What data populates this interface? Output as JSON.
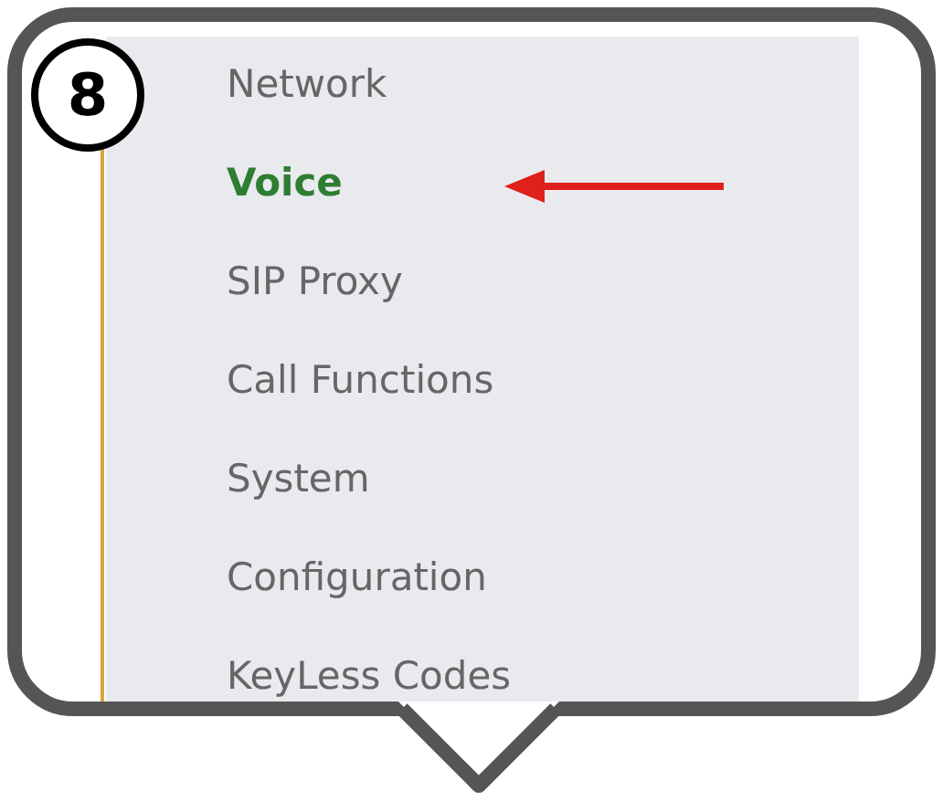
{
  "badge": "8",
  "menu": [
    {
      "label": "Network",
      "selected": false
    },
    {
      "label": "Voice",
      "selected": true
    },
    {
      "label": "SIP Proxy",
      "selected": false
    },
    {
      "label": "Call Functions",
      "selected": false
    },
    {
      "label": "System",
      "selected": false
    },
    {
      "label": "Configuration",
      "selected": false
    },
    {
      "label": "KeyLess Codes",
      "selected": false
    }
  ]
}
